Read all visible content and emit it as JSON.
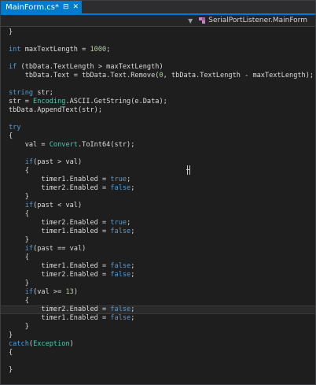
{
  "tab": {
    "title": "MainForm.cs*",
    "pin_glyph": "⊟",
    "close_glyph": "✕"
  },
  "navbar": {
    "dropdown_arrow": "▼",
    "member": "SerialPortListener.MainForm",
    "icon": "class-icon"
  },
  "colors": {
    "keyword": "#569cd6",
    "type": "#4ec9b0",
    "number": "#b5cea8",
    "text": "#dcdcdc",
    "tab_accent": "#007acc"
  },
  "code": {
    "lines": [
      {
        "parts": [
          [
            "t",
            "}"
          ]
        ]
      },
      {
        "parts": []
      },
      {
        "parts": [
          [
            "k",
            "int"
          ],
          [
            "t",
            " maxTextLength = "
          ],
          [
            "n",
            "1000"
          ],
          [
            "t",
            ";"
          ]
        ]
      },
      {
        "parts": []
      },
      {
        "parts": [
          [
            "k",
            "if"
          ],
          [
            "t",
            " (tbData.TextLength > maxTextLength)"
          ]
        ]
      },
      {
        "parts": [
          [
            "t",
            "    tbData.Text = tbData.Text.Remove("
          ],
          [
            "n",
            "0"
          ],
          [
            "t",
            ", tbData.TextLength - maxTextLength);"
          ]
        ]
      },
      {
        "parts": []
      },
      {
        "parts": [
          [
            "k",
            "string"
          ],
          [
            "t",
            " str;"
          ]
        ]
      },
      {
        "parts": [
          [
            "t",
            "str = "
          ],
          [
            "y",
            "Encoding"
          ],
          [
            "t",
            ".ASCII.GetString(e.Data);"
          ]
        ]
      },
      {
        "parts": [
          [
            "t",
            "tbData.AppendText(str);"
          ]
        ]
      },
      {
        "parts": []
      },
      {
        "parts": [
          [
            "k",
            "try"
          ]
        ]
      },
      {
        "parts": [
          [
            "t",
            "{"
          ]
        ]
      },
      {
        "parts": [
          [
            "t",
            "    val = "
          ],
          [
            "y",
            "Convert"
          ],
          [
            "t",
            ".ToInt64(str);"
          ]
        ]
      },
      {
        "parts": []
      },
      {
        "parts": [
          [
            "t",
            "    "
          ],
          [
            "k",
            "if"
          ],
          [
            "t",
            "(past > val)"
          ]
        ]
      },
      {
        "parts": [
          [
            "t",
            "    {"
          ]
        ]
      },
      {
        "parts": [
          [
            "t",
            "        timer1.Enabled = "
          ],
          [
            "k",
            "true"
          ],
          [
            "t",
            ";"
          ]
        ]
      },
      {
        "parts": [
          [
            "t",
            "        timer2.Enabled = "
          ],
          [
            "k",
            "false"
          ],
          [
            "t",
            ";"
          ]
        ]
      },
      {
        "parts": [
          [
            "t",
            "    }"
          ]
        ]
      },
      {
        "parts": [
          [
            "t",
            "    "
          ],
          [
            "k",
            "if"
          ],
          [
            "t",
            "(past < val)"
          ]
        ]
      },
      {
        "parts": [
          [
            "t",
            "    {"
          ]
        ]
      },
      {
        "parts": [
          [
            "t",
            "        timer2.Enabled = "
          ],
          [
            "k",
            "true"
          ],
          [
            "t",
            ";"
          ]
        ]
      },
      {
        "parts": [
          [
            "t",
            "        timer1.Enabled = "
          ],
          [
            "k",
            "false"
          ],
          [
            "t",
            ";"
          ]
        ]
      },
      {
        "parts": [
          [
            "t",
            "    }"
          ]
        ]
      },
      {
        "parts": [
          [
            "t",
            "    "
          ],
          [
            "k",
            "if"
          ],
          [
            "t",
            "(past == val)"
          ]
        ]
      },
      {
        "parts": [
          [
            "t",
            "    {"
          ]
        ]
      },
      {
        "parts": [
          [
            "t",
            "        timer1.Enabled = "
          ],
          [
            "k",
            "false"
          ],
          [
            "t",
            ";"
          ]
        ]
      },
      {
        "parts": [
          [
            "t",
            "        timer2.Enabled = "
          ],
          [
            "k",
            "false"
          ],
          [
            "t",
            ";"
          ]
        ]
      },
      {
        "parts": [
          [
            "t",
            "    }"
          ]
        ]
      },
      {
        "parts": [
          [
            "t",
            "    "
          ],
          [
            "k",
            "if"
          ],
          [
            "t",
            "(val >= "
          ],
          [
            "n",
            "13"
          ],
          [
            "t",
            ")"
          ]
        ]
      },
      {
        "parts": [
          [
            "t",
            "    {"
          ]
        ]
      },
      {
        "parts": [
          [
            "t",
            "        timer2.Enabled = "
          ],
          [
            "k",
            "false"
          ],
          [
            "t",
            ";"
          ]
        ],
        "highlight": true
      },
      {
        "parts": [
          [
            "t",
            "        timer1.Enabled = "
          ],
          [
            "k",
            "false"
          ],
          [
            "t",
            ";"
          ]
        ]
      },
      {
        "parts": [
          [
            "t",
            "    }"
          ]
        ]
      },
      {
        "parts": [
          [
            "t",
            "}"
          ]
        ]
      },
      {
        "parts": [
          [
            "k",
            "catch"
          ],
          [
            "t",
            "("
          ],
          [
            "y",
            "Exception"
          ],
          [
            "t",
            ")"
          ]
        ]
      },
      {
        "parts": [
          [
            "t",
            "{"
          ]
        ]
      },
      {
        "parts": []
      },
      {
        "parts": [
          [
            "t",
            "}"
          ]
        ]
      }
    ]
  }
}
